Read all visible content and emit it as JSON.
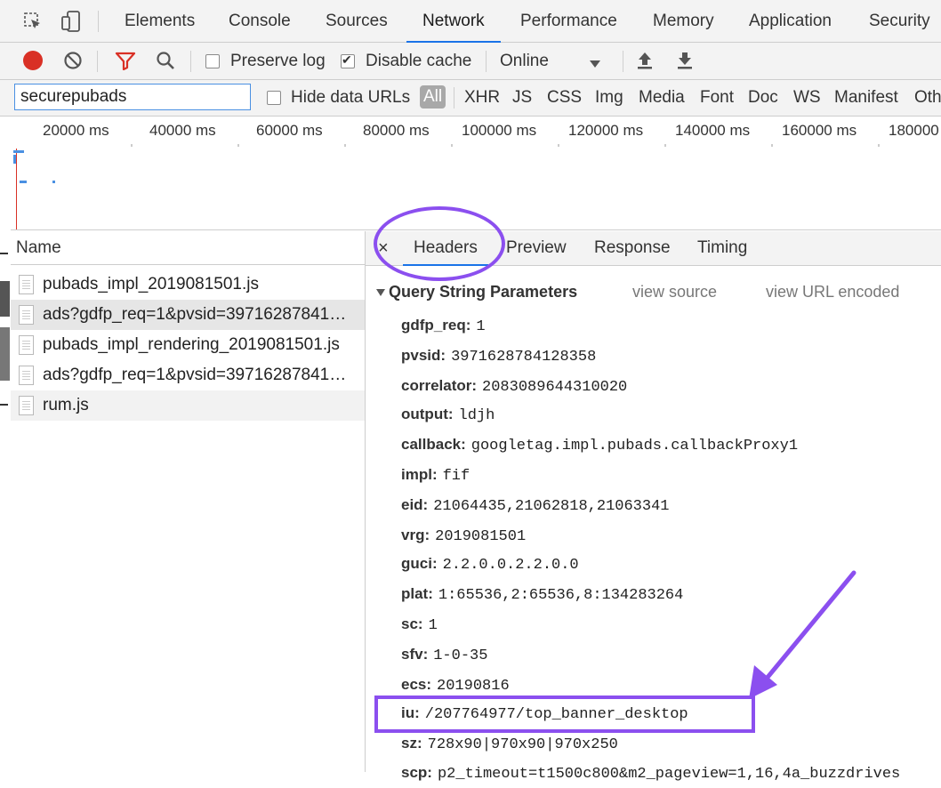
{
  "tabs": [
    "Elements",
    "Console",
    "Sources",
    "Network",
    "Performance",
    "Memory",
    "Application",
    "Security"
  ],
  "active_tab": "Network",
  "toolbar": {
    "preserve_log_label": "Preserve log",
    "preserve_log_checked": false,
    "disable_cache_label": "Disable cache",
    "disable_cache_checked": true,
    "throttle_value": "Online"
  },
  "filter": {
    "value": "securepubads",
    "hide_data_urls_label": "Hide data URLs",
    "types": [
      "All",
      "XHR",
      "JS",
      "CSS",
      "Img",
      "Media",
      "Font",
      "Doc",
      "WS",
      "Manifest",
      "Oth"
    ]
  },
  "timeline_ticks": [
    "20000 ms",
    "40000 ms",
    "60000 ms",
    "80000 ms",
    "100000 ms",
    "120000 ms",
    "140000 ms",
    "160000 ms",
    "180000"
  ],
  "requests": {
    "header": "Name",
    "rows": [
      "pubads_impl_2019081501.js",
      "ads?gdfp_req=1&pvsid=39716287841…",
      "pubads_impl_rendering_2019081501.js",
      "ads?gdfp_req=1&pvsid=39716287841…",
      "rum.js"
    ]
  },
  "detail": {
    "close": "×",
    "tabs": [
      "Headers",
      "Preview",
      "Response",
      "Timing"
    ],
    "active_tab": "Headers",
    "section_title": "Query String Parameters",
    "view_source": "view source",
    "view_url_encoded": "view URL encoded",
    "params": [
      {
        "key": "gdfp_req:",
        "value": "1"
      },
      {
        "key": "pvsid:",
        "value": "3971628784128358"
      },
      {
        "key": "correlator:",
        "value": "2083089644310020"
      },
      {
        "key": "output:",
        "value": "ldjh"
      },
      {
        "key": "callback:",
        "value": "googletag.impl.pubads.callbackProxy1"
      },
      {
        "key": "impl:",
        "value": "fif"
      },
      {
        "key": "eid:",
        "value": "21064435,21062818,21063341"
      },
      {
        "key": "vrg:",
        "value": "2019081501"
      },
      {
        "key": "guci:",
        "value": "2.2.0.0.2.2.0.0"
      },
      {
        "key": "plat:",
        "value": "1:65536,2:65536,8:134283264"
      },
      {
        "key": "sc:",
        "value": "1"
      },
      {
        "key": "sfv:",
        "value": "1-0-35"
      },
      {
        "key": "ecs:",
        "value": "20190816"
      },
      {
        "key": "iu:",
        "value": "/207764977/top_banner_desktop"
      },
      {
        "key": "sz:",
        "value": "728x90|970x90|970x250"
      },
      {
        "key": "scp:",
        "value": "p2_timeout=t1500c800&m2_pageview=1,16,4a_buzzdrives"
      }
    ]
  },
  "colors": {
    "accent": "#1a73e8",
    "annotation": "#8b4fef",
    "record": "#d93025",
    "filter_icon": "#d93025"
  }
}
